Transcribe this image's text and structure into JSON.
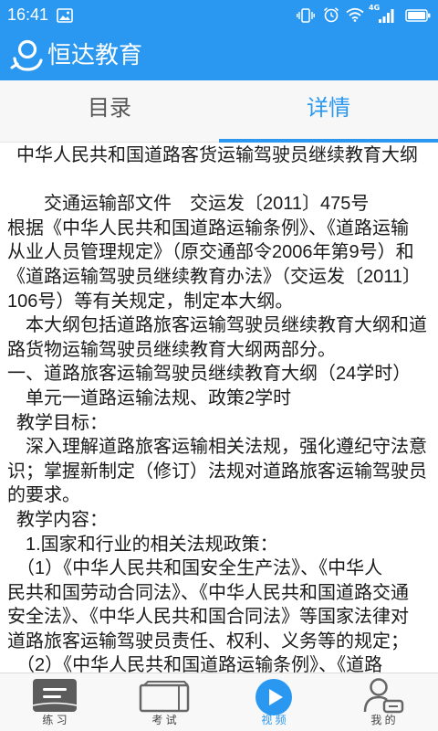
{
  "status_bar": {
    "time": "16:41",
    "network": "4G",
    "icons": [
      "gallery-icon",
      "vibrate-icon",
      "alarm-icon",
      "wifi-icon",
      "signal-icon",
      "battery-icon"
    ]
  },
  "app_bar": {
    "title": "恒达教育",
    "logo_icon": "logo-icon"
  },
  "tabs": [
    {
      "label": "目录",
      "selected": false
    },
    {
      "label": "详情",
      "selected": true
    }
  ],
  "document": {
    "title": "中华人民共和国道路客货运输驾驶员继续教育大纲",
    "lines": [
      "交通运输部文件　交运发〔2011〕475号",
      "根据《中华人民共和国道路运输条例》、《道路运输",
      "从业人员管理规定》（原交通部令2006年第9号）和",
      "《道路运输驾驶员继续教育办法》（交运发〔2011〕",
      "106号）等有关规定，制定本大纲。",
      "本大纲包括道路旅客运输驾驶员继续教育大纲和道",
      "路货物运输驾驶员继续教育大纲两部分。",
      "一、道路旅客运输驾驶员继续教育大纲（24学时）",
      "单元一道路运输法规、政策2学时",
      "教学目标：",
      "深入理解道路旅客运输相关法规，强化遵纪守法意",
      "识；掌握新制定（修订）法规对道路旅客运输驾驶员",
      "的要求。",
      "教学内容：",
      "1.国家和行业的相关法规政策：",
      "（1）《中华人民共和国安全生产法》、《中华人",
      "民共和国劳动合同法》、《中华人民共和国道路交通",
      "安全法》、《中华人民共和国合同法》等国家法律对",
      "道路旅客运输驾驶员责任、权利、义务等的规定；",
      "（2）《中华人民共和国道路运输条例》、《道路"
    ]
  },
  "bottom_nav": [
    {
      "label": "练 习",
      "icon": "notebook-icon",
      "selected": false
    },
    {
      "label": "考 试",
      "icon": "exam-card-icon",
      "selected": false
    },
    {
      "label": "视 频",
      "icon": "play-icon",
      "selected": true
    },
    {
      "label": "我 的",
      "icon": "user-profile-icon",
      "selected": false
    }
  ],
  "colors": {
    "primary": "#2a98f0",
    "text": "#1b1b1b",
    "inactive": "#555555"
  }
}
